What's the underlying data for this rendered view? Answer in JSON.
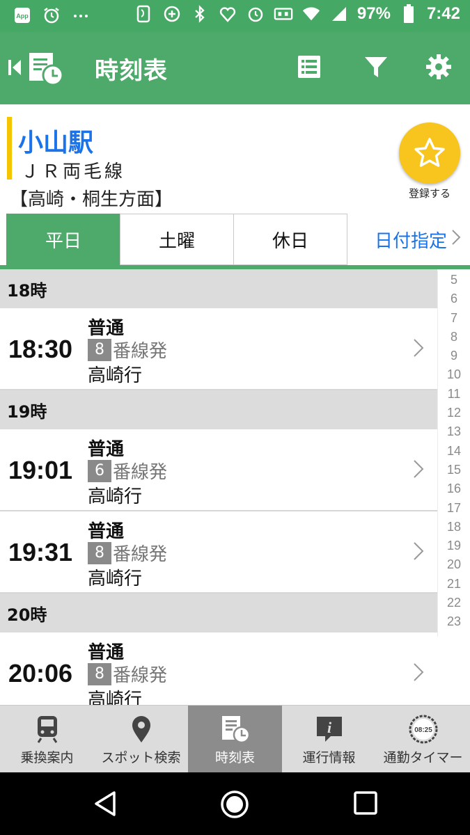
{
  "status_bar": {
    "battery": "97%",
    "time": "7:42",
    "left_icons": [
      "app-icon",
      "alarm-icon",
      "more-icon"
    ],
    "right_icons": [
      "nfc-icon",
      "data-saver-icon",
      "bluetooth-icon",
      "heart-icon",
      "alarm-icon",
      "vibrate-icon",
      "wifi-icon",
      "signal-icon",
      "battery-icon"
    ]
  },
  "app_bar": {
    "title": "時刻表",
    "actions": [
      "list-icon",
      "filter-icon",
      "settings-icon"
    ]
  },
  "station": {
    "name": "小山駅",
    "line": "ＪＲ両毛線",
    "direction": "【高崎・桐生方面】",
    "favorite_label": "登録する",
    "line_color": "#f5c400"
  },
  "day_tabs": {
    "items": [
      {
        "label": "平日",
        "active": true
      },
      {
        "label": "土曜",
        "active": false
      },
      {
        "label": "休日",
        "active": false
      }
    ],
    "date_label": "日付指定"
  },
  "timetable": {
    "groups": [
      {
        "hour": "18時",
        "trains": [
          {
            "time": "18:30",
            "kind": "普通",
            "platform": "8",
            "platform_suffix": "番線発",
            "destination": "高崎行"
          }
        ]
      },
      {
        "hour": "19時",
        "trains": [
          {
            "time": "19:01",
            "kind": "普通",
            "platform": "6",
            "platform_suffix": "番線発",
            "destination": "高崎行"
          },
          {
            "time": "19:31",
            "kind": "普通",
            "platform": "8",
            "platform_suffix": "番線発",
            "destination": "高崎行"
          }
        ]
      },
      {
        "hour": "20時",
        "trains": [
          {
            "time": "20:06",
            "kind": "普通",
            "platform": "8",
            "platform_suffix": "番線発",
            "destination": "高崎行"
          }
        ]
      }
    ]
  },
  "hour_index": [
    "5",
    "6",
    "7",
    "8",
    "9",
    "10",
    "11",
    "12",
    "13",
    "14",
    "15",
    "16",
    "17",
    "18",
    "19",
    "20",
    "21",
    "22",
    "23"
  ],
  "bottom_nav": {
    "items": [
      {
        "label": "乗換案内",
        "icon": "train-icon",
        "active": false
      },
      {
        "label": "スポット検索",
        "icon": "location-pin-icon",
        "active": false
      },
      {
        "label": "時刻表",
        "icon": "timetable-icon",
        "active": true
      },
      {
        "label": "運行情報",
        "icon": "info-icon",
        "active": false
      },
      {
        "label": "通勤タイマー",
        "icon": "timer-icon",
        "active": false
      }
    ],
    "timer_icon_text": "08:25"
  },
  "colors": {
    "primary_green": "#4daa6a",
    "status_green": "#46a865",
    "accent_blue": "#1a73e8",
    "favorite_yellow": "#f7c51e"
  }
}
